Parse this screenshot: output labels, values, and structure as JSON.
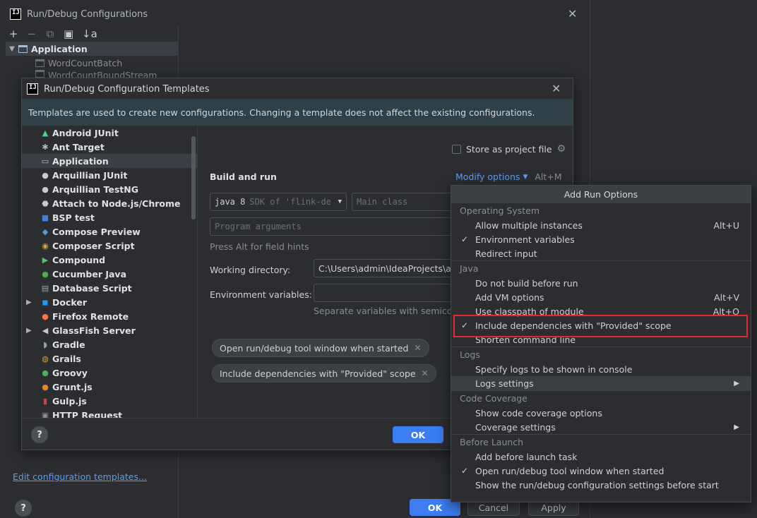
{
  "outer": {
    "title": "Run/Debug Configurations",
    "toolbar": [
      "+",
      "−",
      "⧉",
      "▣",
      "↓a"
    ],
    "tree": {
      "group_label": "Application",
      "children": [
        "WordCountBatch",
        "WordCountBoundStream"
      ]
    },
    "edit_templates_link": "Edit configuration templates...",
    "help": "?",
    "ok": "OK",
    "cancel": "Cancel",
    "apply": "Apply"
  },
  "templates": {
    "title": "Run/Debug Configuration Templates",
    "banner": "Templates are used to create new configurations. Changing a template does not affect the existing configurations.",
    "items": [
      {
        "label": "Android JUnit",
        "icon": "android-icon",
        "glyph": "▲",
        "color": "#3ddc84"
      },
      {
        "label": "Ant Target",
        "icon": "ant-icon",
        "glyph": "✱",
        "color": "#b0b3b8"
      },
      {
        "label": "Application",
        "icon": "application-icon",
        "glyph": "▭",
        "color": "#a9c0d4"
      },
      {
        "label": "Arquillian JUnit",
        "icon": "arquillian-icon",
        "glyph": "●",
        "color": "#c8cacd"
      },
      {
        "label": "Arquillian TestNG",
        "icon": "arquillian-icon",
        "glyph": "●",
        "color": "#c8cacd"
      },
      {
        "label": "Attach to Node.js/Chrome",
        "icon": "nodejs-icon",
        "glyph": "⬣",
        "color": "#c8cacd"
      },
      {
        "label": "BSP test",
        "icon": "bsp-icon",
        "glyph": "■",
        "color": "#3f7fd6"
      },
      {
        "label": "Compose Preview",
        "icon": "compose-icon",
        "glyph": "◆",
        "color": "#4aa3df"
      },
      {
        "label": "Composer Script",
        "icon": "composer-icon",
        "glyph": "◉",
        "color": "#d9a441"
      },
      {
        "label": "Compound",
        "icon": "compound-icon",
        "glyph": "▶",
        "color": "#5fb86f"
      },
      {
        "label": "Cucumber Java",
        "icon": "cucumber-icon",
        "glyph": "●",
        "color": "#4cae4f"
      },
      {
        "label": "Database Script",
        "icon": "database-icon",
        "glyph": "▤",
        "color": "#8fa9c2"
      },
      {
        "label": "Docker",
        "icon": "docker-icon",
        "glyph": "◼",
        "color": "#2496ed",
        "expandable": true
      },
      {
        "label": "Firefox Remote",
        "icon": "firefox-icon",
        "glyph": "●",
        "color": "#ff7139"
      },
      {
        "label": "GlassFish Server",
        "icon": "glassfish-icon",
        "glyph": "◀",
        "color": "#c8cacd",
        "expandable": true
      },
      {
        "label": "Gradle",
        "icon": "gradle-icon",
        "glyph": "◗",
        "color": "#9aa0a6"
      },
      {
        "label": "Grails",
        "icon": "grails-icon",
        "glyph": "◍",
        "color": "#e0a020"
      },
      {
        "label": "Groovy",
        "icon": "groovy-icon",
        "glyph": "●",
        "color": "#4eb05b"
      },
      {
        "label": "Grunt.js",
        "icon": "grunt-icon",
        "glyph": "●",
        "color": "#e48632"
      },
      {
        "label": "Gulp.js",
        "icon": "gulp-icon",
        "glyph": "▮",
        "color": "#cf4647"
      },
      {
        "label": "HTTP Request",
        "icon": "http-icon",
        "glyph": "▣",
        "color": "#8a8d92"
      }
    ],
    "store_as_project_file": "Store as project file",
    "build_and_run": "Build and run",
    "modify_options": "Modify options",
    "modify_shortcut": "Alt+M",
    "jdk_field": "java 8",
    "jdk_hint": "SDK of 'flink-demo'",
    "main_class_placeholder": "Main class",
    "program_args_placeholder": "Program arguments",
    "field_hints": "Press Alt for field hints",
    "working_dir_label": "Working directory:",
    "working_dir_value": "C:\\Users\\admin\\IdeaProjects\\atg",
    "env_vars_label": "Environment variables:",
    "env_vars_hint": "Separate variables with semicolon",
    "chips": [
      "Open run/debug tool window when started",
      "Include dependencies with \"Provided\" scope"
    ],
    "help": "?",
    "ok": "OK"
  },
  "popup": {
    "header": "Add Run Options",
    "groups": [
      {
        "title": "Operating System",
        "items": [
          {
            "label": "Allow multiple instances",
            "shortcut": "Alt+U",
            "checked": false
          },
          {
            "label": "Environment variables",
            "shortcut": "",
            "checked": true
          },
          {
            "label": "Redirect input",
            "shortcut": "",
            "checked": false
          }
        ]
      },
      {
        "title": "Java",
        "items": [
          {
            "label": "Do not build before run",
            "shortcut": "",
            "checked": false
          },
          {
            "label": "Add VM options",
            "shortcut": "Alt+V",
            "checked": false
          },
          {
            "label": "Use classpath of module",
            "shortcut": "Alt+O",
            "checked": false
          },
          {
            "label": "Include dependencies with \"Provided\" scope",
            "shortcut": "",
            "checked": true
          },
          {
            "label": "Shorten command line",
            "shortcut": "",
            "checked": false
          }
        ]
      },
      {
        "title": "Logs",
        "items": [
          {
            "label": "Specify logs to be shown in console",
            "shortcut": "",
            "checked": false
          },
          {
            "label": "Logs settings",
            "shortcut": "",
            "checked": false,
            "submenu": true,
            "selected": true
          }
        ]
      },
      {
        "title": "Code Coverage",
        "items": [
          {
            "label": "Show code coverage options",
            "shortcut": "",
            "checked": false
          },
          {
            "label": "Coverage settings",
            "shortcut": "",
            "checked": false,
            "submenu": true
          }
        ]
      },
      {
        "title": "Before Launch",
        "items": [
          {
            "label": "Add before launch task",
            "shortcut": "",
            "checked": false
          },
          {
            "label": "Open run/debug tool window when started",
            "shortcut": "",
            "checked": true
          },
          {
            "label": "Show the run/debug configuration settings before start",
            "shortcut": "",
            "checked": false
          }
        ]
      }
    ]
  },
  "colors": {
    "accent": "#3c7ef2",
    "link": "#5c9ded",
    "highlight_box": "#e02b2b",
    "banner": "#2d4146"
  }
}
